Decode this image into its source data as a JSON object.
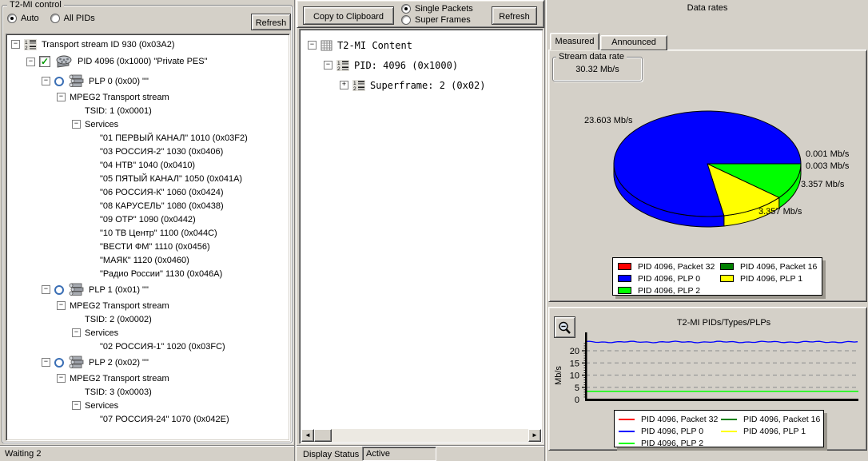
{
  "left_panel": {
    "group_title": "T2-MI control",
    "radios": [
      {
        "label": "Auto",
        "selected": true
      },
      {
        "label": "All PIDs",
        "selected": false
      }
    ],
    "refresh_button": "Refresh",
    "status": "Waiting 2",
    "tree": [
      {
        "level": 0,
        "expand": "-",
        "icon": "numlist",
        "text": "Transport stream ID 930 (0x03A2)"
      },
      {
        "level": 1,
        "expand": "-",
        "check": true,
        "icon": "reel",
        "text": "PID 4096 (0x1000) \"Private PES\"",
        "size": "large"
      },
      {
        "level": 2,
        "expand": "-",
        "circle": true,
        "icon": "pipes",
        "text": "PLP 0 (0x00) \"\"",
        "size": "med"
      },
      {
        "level": 3,
        "expand": "-",
        "text": "MPEG2 Transport stream"
      },
      {
        "level": 4,
        "text": "TSID: 1 (0x0001)"
      },
      {
        "level": 4,
        "expand": "-",
        "text": "Services"
      },
      {
        "level": 5,
        "text": "\"01 ПЕРВЫЙ КАНАЛ\" 1010 (0x03F2)"
      },
      {
        "level": 5,
        "text": "\"03 РОССИЯ-2\" 1030 (0x0406)"
      },
      {
        "level": 5,
        "text": "\"04 НТВ\" 1040 (0x0410)"
      },
      {
        "level": 5,
        "text": "\"05 ПЯТЫЙ КАНАЛ\" 1050 (0x041A)"
      },
      {
        "level": 5,
        "text": "\"06 РОССИЯ-К\" 1060 (0x0424)"
      },
      {
        "level": 5,
        "text": "\"08 КАРУСЕЛЬ\" 1080 (0x0438)"
      },
      {
        "level": 5,
        "text": "\"09 ОТР\" 1090 (0x0442)"
      },
      {
        "level": 5,
        "text": "\"10 ТВ Центр\" 1100 (0x044C)"
      },
      {
        "level": 5,
        "text": "\"ВЕСТИ ФМ\" 1110 (0x0456)"
      },
      {
        "level": 5,
        "text": "\"МАЯК\" 1120 (0x0460)"
      },
      {
        "level": 5,
        "text": "\"Радио России\" 1130 (0x046A)"
      },
      {
        "level": 2,
        "expand": "-",
        "circle": true,
        "icon": "pipes",
        "text": "PLP 1 (0x01) \"\"",
        "size": "med"
      },
      {
        "level": 3,
        "expand": "-",
        "text": "MPEG2 Transport stream"
      },
      {
        "level": 4,
        "text": "TSID: 2 (0x0002)"
      },
      {
        "level": 4,
        "expand": "-",
        "text": "Services"
      },
      {
        "level": 5,
        "text": "\"02 РОССИЯ-1\" 1020 (0x03FC)"
      },
      {
        "level": 2,
        "expand": "-",
        "circle": true,
        "icon": "pipes",
        "text": "PLP 2 (0x02) \"\"",
        "size": "med"
      },
      {
        "level": 3,
        "expand": "-",
        "text": "MPEG2 Transport stream"
      },
      {
        "level": 4,
        "text": "TSID: 3 (0x0003)"
      },
      {
        "level": 4,
        "expand": "-",
        "text": "Services"
      },
      {
        "level": 5,
        "text": "\"07 РОССИЯ-24\" 1070 (0x042E)"
      }
    ]
  },
  "middle_panel": {
    "copy_button": "Copy to Clipboard",
    "radios": [
      {
        "label": "Single Packets",
        "selected": true
      },
      {
        "label": "Super Frames",
        "selected": false
      }
    ],
    "refresh_button": "Refresh",
    "tree": [
      {
        "level": 0,
        "expand": "-",
        "icon": "grid",
        "text": "T2-MI Content"
      },
      {
        "level": 1,
        "expand": "-",
        "icon": "numlist",
        "text": "PID: 4096 (0x1000)"
      },
      {
        "level": 2,
        "expand": "+",
        "icon": "numlist",
        "text": "Superframe: 2 (0x02)"
      }
    ],
    "display_status_label": "Display Status",
    "display_status_value": "Active"
  },
  "right_panel": {
    "title": "Data rates",
    "tabs": [
      {
        "label": "Measured",
        "active": true
      },
      {
        "label": "Announced",
        "active": false
      }
    ],
    "stream_group": {
      "title": "Stream data rate",
      "value": "30.32 Mb/s"
    },
    "legend": [
      {
        "label": "PID 4096, Packet 32",
        "color": "#ff0000"
      },
      {
        "label": "PID 4096, Packet 16",
        "color": "#008000"
      },
      {
        "label": "PID 4096, PLP 0",
        "color": "#0000ff"
      },
      {
        "label": "PID 4096, PLP 1",
        "color": "#ffff00"
      },
      {
        "label": "PID 4096, PLP 2",
        "color": "#00ff00"
      }
    ]
  },
  "chart_data": [
    {
      "type": "pie",
      "title": "Data rates (Measured)",
      "unit": "Mb/s",
      "stream_total": "30.32 Mb/s",
      "labels": [
        "PID 4096, Packet 32",
        "PID 4096, Packet 16",
        "PID 4096, PLP 0",
        "PID 4096, PLP 1",
        "PID 4096, PLP 2"
      ],
      "values": [
        0.001,
        0.003,
        23.603,
        3.357,
        3.357
      ],
      "colors": [
        "#ff0000",
        "#008000",
        "#0000ff",
        "#ffff00",
        "#00ff00"
      ],
      "style": "3d-pie",
      "legend_position": "below"
    },
    {
      "type": "line",
      "title": "T2-MI PIDs/Types/PLPs",
      "ylabel": "Mb/s",
      "yticks": [
        0,
        5,
        10,
        15,
        20
      ],
      "ylim": [
        0,
        26
      ],
      "grid": "dashed-horizontal",
      "legend_position": "below",
      "series": [
        {
          "name": "PID 4096, Packet 32",
          "color": "#ff0000",
          "value": 0.001
        },
        {
          "name": "PID 4096, Packet 16",
          "color": "#008000",
          "value": 0.003
        },
        {
          "name": "PID 4096, PLP 0",
          "color": "#0000ff",
          "value": 23.603,
          "noise": true
        },
        {
          "name": "PID 4096, PLP 1",
          "color": "#ffff00",
          "value": 3.357
        },
        {
          "name": "PID 4096, PLP 2",
          "color": "#00ff00",
          "value": 3.357
        }
      ]
    }
  ]
}
